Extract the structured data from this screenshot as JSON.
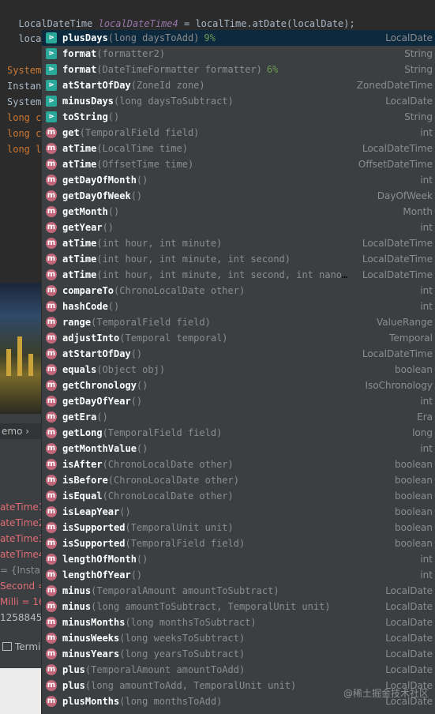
{
  "editor": {
    "line1": {
      "type": "LocalDateTime",
      "var": "localDateTime4",
      "rest": " = localTime.atDate(localDate);"
    },
    "line2": "localDate."
  },
  "background_lines": [
    {
      "text": "System",
      "color": "#cc7832"
    },
    {
      "text": "Instan",
      "color": "#a9b7c6"
    },
    {
      "text": "System",
      "color": "#a9b7c6"
    },
    {
      "text": "long c",
      "color": "#cc7832"
    },
    {
      "text": "long c",
      "color": "#cc7832"
    },
    {
      "text": "long l",
      "color": "#cc7832"
    }
  ],
  "tool_window": {
    "header": "emo",
    "variables": [
      {
        "text": "ateTime1",
        "color": "#e06c75"
      },
      {
        "text": "ateTime2",
        "color": "#e06c75"
      },
      {
        "text": "ateTime3",
        "color": "#e06c75"
      },
      {
        "text": "ateTime4",
        "color": "#e06c75"
      },
      {
        "text": "= {Instan",
        "color": "#8c8c8c"
      },
      {
        "text": "Second =",
        "color": "#e06c75"
      },
      {
        "text": "Milli = 16",
        "color": "#e06c75"
      },
      {
        "text": "12588458",
        "color": "#bbbbbb"
      }
    ],
    "terminal_tab": "Termi"
  },
  "colors": {
    "editor_bg": "#2b2b2b",
    "popup_bg": "#3c3f41",
    "selected_row": "#0d293e",
    "method_icon": "#c2667a",
    "live_template_icon": "#2aa89a"
  },
  "completions": [
    {
      "icon": "live-template",
      "name": "plusDays",
      "params": "(long daysToAdd)",
      "pct": "9%",
      "ret": "LocalDate"
    },
    {
      "icon": "live-template",
      "name": "format",
      "params": "(formatter2)",
      "pct": "",
      "ret": "String"
    },
    {
      "icon": "live-template",
      "name": "format",
      "params": "(DateTimeFormatter formatter)",
      "pct": "6%",
      "ret": "String"
    },
    {
      "icon": "live-template",
      "name": "atStartOfDay",
      "params": "(ZoneId zone)",
      "pct": "",
      "ret": "ZonedDateTime"
    },
    {
      "icon": "live-template",
      "name": "minusDays",
      "params": "(long daysToSubtract)",
      "pct": "",
      "ret": "LocalDate"
    },
    {
      "icon": "live-template",
      "name": "toString",
      "params": "()",
      "pct": "",
      "ret": "String"
    },
    {
      "icon": "method",
      "name": "get",
      "params": "(TemporalField field)",
      "pct": "",
      "ret": "int"
    },
    {
      "icon": "method",
      "name": "atTime",
      "params": "(LocalTime time)",
      "pct": "",
      "ret": "LocalDateTime"
    },
    {
      "icon": "method",
      "name": "atTime",
      "params": "(OffsetTime time)",
      "pct": "",
      "ret": "OffsetDateTime"
    },
    {
      "icon": "method",
      "name": "getDayOfMonth",
      "params": "()",
      "pct": "",
      "ret": "int"
    },
    {
      "icon": "method",
      "name": "getDayOfWeek",
      "params": "()",
      "pct": "",
      "ret": "DayOfWeek"
    },
    {
      "icon": "method",
      "name": "getMonth",
      "params": "()",
      "pct": "",
      "ret": "Month"
    },
    {
      "icon": "method",
      "name": "getYear",
      "params": "()",
      "pct": "",
      "ret": "int"
    },
    {
      "icon": "method",
      "name": "atTime",
      "params": "(int hour, int minute)",
      "pct": "",
      "ret": "LocalDateTime"
    },
    {
      "icon": "method",
      "name": "atTime",
      "params": "(int hour, int minute, int second)",
      "pct": "",
      "ret": "LocalDateTime"
    },
    {
      "icon": "method",
      "name": "atTime",
      "params": "(int hour, int minute, int second, int nanoO…",
      "pct": "",
      "ret": "LocalDateTime"
    },
    {
      "icon": "method",
      "name": "compareTo",
      "params": "(ChronoLocalDate other)",
      "pct": "",
      "ret": "int"
    },
    {
      "icon": "method",
      "name": "hashCode",
      "params": "()",
      "pct": "",
      "ret": "int"
    },
    {
      "icon": "method",
      "name": "range",
      "params": "(TemporalField field)",
      "pct": "",
      "ret": "ValueRange"
    },
    {
      "icon": "method",
      "name": "adjustInto",
      "params": "(Temporal temporal)",
      "pct": "",
      "ret": "Temporal"
    },
    {
      "icon": "method",
      "name": "atStartOfDay",
      "params": "()",
      "pct": "",
      "ret": "LocalDateTime"
    },
    {
      "icon": "method",
      "name": "equals",
      "params": "(Object obj)",
      "pct": "",
      "ret": "boolean"
    },
    {
      "icon": "method",
      "name": "getChronology",
      "params": "()",
      "pct": "",
      "ret": "IsoChronology"
    },
    {
      "icon": "method",
      "name": "getDayOfYear",
      "params": "()",
      "pct": "",
      "ret": "int"
    },
    {
      "icon": "method",
      "name": "getEra",
      "params": "()",
      "pct": "",
      "ret": "Era"
    },
    {
      "icon": "method",
      "name": "getLong",
      "params": "(TemporalField field)",
      "pct": "",
      "ret": "long"
    },
    {
      "icon": "method",
      "name": "getMonthValue",
      "params": "()",
      "pct": "",
      "ret": "int"
    },
    {
      "icon": "method",
      "name": "isAfter",
      "params": "(ChronoLocalDate other)",
      "pct": "",
      "ret": "boolean"
    },
    {
      "icon": "method",
      "name": "isBefore",
      "params": "(ChronoLocalDate other)",
      "pct": "",
      "ret": "boolean"
    },
    {
      "icon": "method",
      "name": "isEqual",
      "params": "(ChronoLocalDate other)",
      "pct": "",
      "ret": "boolean"
    },
    {
      "icon": "method",
      "name": "isLeapYear",
      "params": "()",
      "pct": "",
      "ret": "boolean"
    },
    {
      "icon": "method",
      "name": "isSupported",
      "params": "(TemporalUnit unit)",
      "pct": "",
      "ret": "boolean"
    },
    {
      "icon": "method",
      "name": "isSupported",
      "params": "(TemporalField field)",
      "pct": "",
      "ret": "boolean"
    },
    {
      "icon": "method",
      "name": "lengthOfMonth",
      "params": "()",
      "pct": "",
      "ret": "int"
    },
    {
      "icon": "method",
      "name": "lengthOfYear",
      "params": "()",
      "pct": "",
      "ret": "int"
    },
    {
      "icon": "method",
      "name": "minus",
      "params": "(TemporalAmount amountToSubtract)",
      "pct": "",
      "ret": "LocalDate"
    },
    {
      "icon": "method",
      "name": "minus",
      "params": "(long amountToSubtract, TemporalUnit unit)",
      "pct": "",
      "ret": "LocalDate"
    },
    {
      "icon": "method",
      "name": "minusMonths",
      "params": "(long monthsToSubtract)",
      "pct": "",
      "ret": "LocalDate"
    },
    {
      "icon": "method",
      "name": "minusWeeks",
      "params": "(long weeksToSubtract)",
      "pct": "",
      "ret": "LocalDate"
    },
    {
      "icon": "method",
      "name": "minusYears",
      "params": "(long yearsToSubtract)",
      "pct": "",
      "ret": "LocalDate"
    },
    {
      "icon": "method",
      "name": "plus",
      "params": "(TemporalAmount amountToAdd)",
      "pct": "",
      "ret": "LocalDate"
    },
    {
      "icon": "method",
      "name": "plus",
      "params": "(long amountToAdd, TemporalUnit unit)",
      "pct": "",
      "ret": "LocalDate"
    },
    {
      "icon": "method",
      "name": "plusMonths",
      "params": "(long monthsToAdd)",
      "pct": "",
      "ret": "LocalDate"
    }
  ],
  "icon_glyphs": {
    "method": "m",
    "live-template": "⋗"
  },
  "watermark": "@稀土掘金技术社区"
}
